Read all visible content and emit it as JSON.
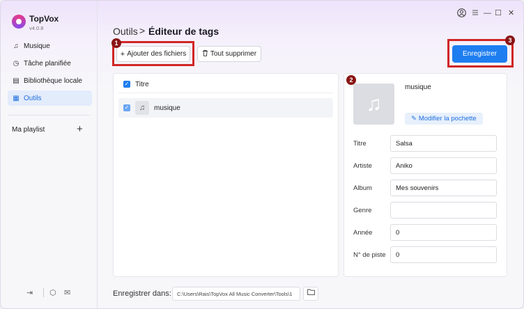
{
  "app": {
    "name": "TopVox",
    "version": "v4.0.8"
  },
  "window_controls": {
    "user_icon": "user-icon",
    "menu_icon": "menu-icon",
    "minimize": "—",
    "maximize": "☐",
    "close": "✕"
  },
  "sidebar": {
    "items": [
      {
        "label": "Musique",
        "icon": "headphones-icon",
        "glyph": "♫"
      },
      {
        "label": "Tâche planifiée",
        "icon": "clock-icon",
        "glyph": "◷"
      },
      {
        "label": "Bibliothèque locale",
        "icon": "library-icon",
        "glyph": "▤"
      },
      {
        "label": "Outils",
        "icon": "grid-icon",
        "glyph": "▦",
        "active": true
      }
    ],
    "playlist_label": "Ma playlist",
    "playlist_add": "+",
    "footer": {
      "collapse": "⇥",
      "settings": "⬡",
      "mail": "✉"
    }
  },
  "header": {
    "breadcrumb_parent": "Outils",
    "breadcrumb_sep": ">",
    "breadcrumb_current": "Éditeur de tags"
  },
  "toolbar": {
    "add_label": "Ajouter des fichiers",
    "add_glyph": "+",
    "delete_label": "Tout supprimer",
    "delete_glyph": "🗑",
    "save_label": "Enregistrer"
  },
  "badges": [
    "1",
    "2",
    "3"
  ],
  "file_list": {
    "header_label": "Titre",
    "rows": [
      {
        "label": "musique",
        "glyph": "♫",
        "checked": true
      }
    ]
  },
  "tag_editor": {
    "cover_title": "musique",
    "cover_glyph": "♫",
    "cover_button": "Modifier la pochette",
    "cover_button_glyph": "✎",
    "fields": [
      {
        "label": "Titre",
        "value": "Salsa"
      },
      {
        "label": "Artiste",
        "value": "Aniko"
      },
      {
        "label": "Album",
        "value": "Mes souvenirs"
      },
      {
        "label": "Genre",
        "value": ""
      },
      {
        "label": "Année",
        "value": "0"
      },
      {
        "label": "N° de piste",
        "value": "0"
      }
    ]
  },
  "save_location": {
    "label": "Enregistrer dans:",
    "path": "C:\\Users\\Rais\\TopVox All Music Converter\\Tools\\1",
    "folder_glyph": "🗀"
  },
  "colors": {
    "accent": "#1e7ef0",
    "highlight_box": "#d02626",
    "badge": "#8a1414",
    "active_nav_bg": "#e3ecfb"
  }
}
